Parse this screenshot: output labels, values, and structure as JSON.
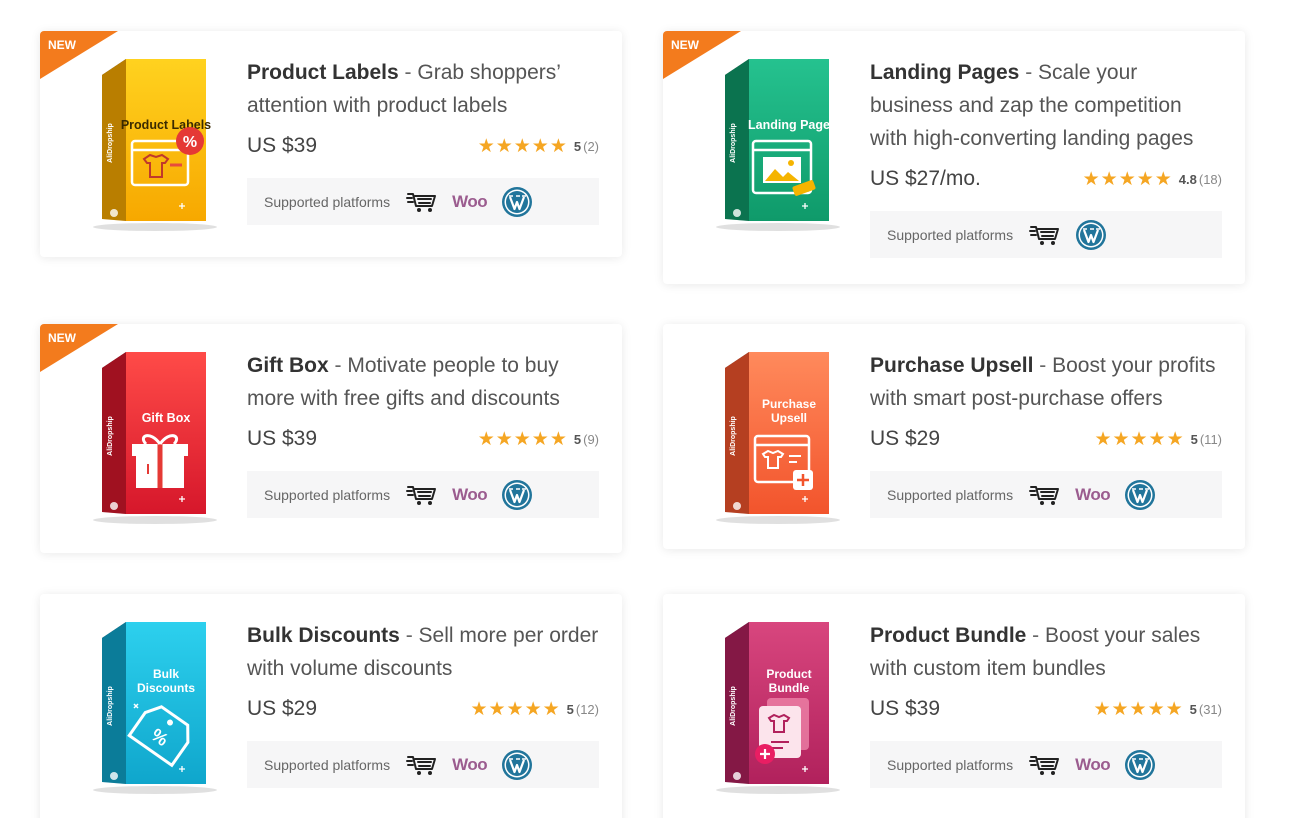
{
  "platforms_label": "Supported platforms",
  "woo_label": "Woo",
  "new_label": "NEW",
  "products": [
    {
      "name": "Product Labels",
      "desc": "Grab shoppers’ attention with product labels",
      "price": "US $39",
      "score": "5",
      "count": "(2)",
      "is_new": true,
      "box_title": "Product Labels",
      "box_brand": "AliDropship",
      "colors": [
        "#ffd21f",
        "#f7a800"
      ],
      "icon": "tag-icon",
      "platforms": [
        "cart",
        "woo",
        "wordpress"
      ]
    },
    {
      "name": "Landing Pages",
      "desc": "Scale your business and zap the competition with high-converting landing pages",
      "price": "US $27/mo.",
      "score": "4.8",
      "count": "(18)",
      "is_new": true,
      "box_title": "Landing Page",
      "box_brand": "AliDropship",
      "colors": [
        "#25c28f",
        "#0f9a6a"
      ],
      "icon": "landing-icon",
      "platforms": [
        "cart",
        "wordpress"
      ]
    },
    {
      "name": "Gift Box",
      "desc": "Motivate people to buy more with free gifts and discounts",
      "price": "US $39",
      "score": "5",
      "count": "(9)",
      "is_new": true,
      "box_title": "Gift Box",
      "box_brand": "AliDropship",
      "colors": [
        "#ff4b48",
        "#d6172b"
      ],
      "icon": "gift-icon",
      "platforms": [
        "cart",
        "woo",
        "wordpress"
      ]
    },
    {
      "name": "Purchase Upsell",
      "desc": "Boost your profits with smart post-purchase offers",
      "price": "US $29",
      "score": "5",
      "count": "(11)",
      "is_new": false,
      "box_title": "Purchase Upsell",
      "box_brand": "AliDropship",
      "colors": [
        "#ff8a5c",
        "#f2542c"
      ],
      "icon": "upsell-icon",
      "platforms": [
        "cart",
        "woo",
        "wordpress"
      ]
    },
    {
      "name": "Bulk Discounts",
      "desc": "Sell more per order with volume discounts",
      "price": "US $29",
      "score": "5",
      "count": "(12)",
      "is_new": false,
      "box_title": "Bulk Discounts",
      "box_brand": "AliDropship",
      "colors": [
        "#2dd0ee",
        "#0fa6cc"
      ],
      "icon": "discount-tag-icon",
      "platforms": [
        "cart",
        "woo",
        "wordpress"
      ]
    },
    {
      "name": "Product Bundle",
      "desc": "Boost your sales with custom item bundles",
      "price": "US $39",
      "score": "5",
      "count": "(31)",
      "is_new": false,
      "box_title": "Product Bundle",
      "box_brand": "AliDropship",
      "colors": [
        "#d8467e",
        "#b1215c"
      ],
      "icon": "bundle-icon",
      "platforms": [
        "cart",
        "woo",
        "wordpress"
      ]
    }
  ]
}
